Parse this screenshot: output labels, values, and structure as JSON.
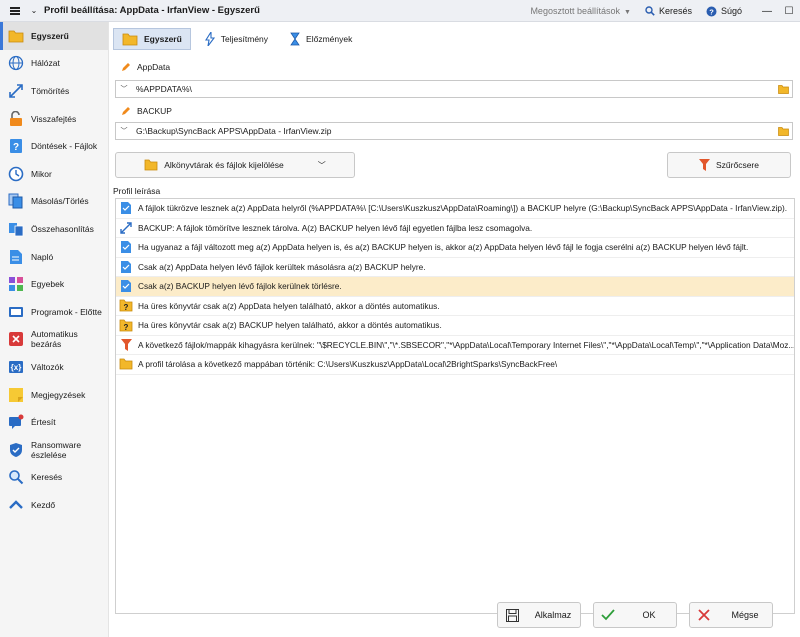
{
  "window": {
    "title": "Profil beállítása: AppData - IrfanView - Egyszerű",
    "shared_settings": "Megosztott beállítások",
    "search": "Keresés",
    "help": "Súgó"
  },
  "sidebar": {
    "items": [
      {
        "label": "Egyszerű",
        "icon": "folder-icon"
      },
      {
        "label": "Hálózat",
        "icon": "network-icon"
      },
      {
        "label": "Tömörítés",
        "icon": "compress-icon"
      },
      {
        "label": "Visszafejtés",
        "icon": "unlock-icon"
      },
      {
        "label": "Döntések - Fájlok",
        "icon": "question-icon"
      },
      {
        "label": "Mikor",
        "icon": "clock-icon"
      },
      {
        "label": "Másolás/Törlés",
        "icon": "copy-icon"
      },
      {
        "label": "Összehasonlítás",
        "icon": "compare-icon"
      },
      {
        "label": "Napló",
        "icon": "log-icon"
      },
      {
        "label": "Egyebek",
        "icon": "misc-icon"
      },
      {
        "label": "Programok - Előtte",
        "icon": "programs-icon"
      },
      {
        "label": "Automatikus bezárás",
        "icon": "auto-close-icon"
      },
      {
        "label": "Változók",
        "icon": "variables-icon"
      },
      {
        "label": "Megjegyzések",
        "icon": "notes-icon"
      },
      {
        "label": "Értesít",
        "icon": "notify-icon"
      },
      {
        "label": "Ransomware észlelése",
        "icon": "ransomware-icon"
      },
      {
        "label": "Keresés",
        "icon": "search-icon"
      },
      {
        "label": "Kezdő",
        "icon": "beginner-icon"
      }
    ]
  },
  "tabs": [
    {
      "label": "Egyszerű"
    },
    {
      "label": "Teljesítmény"
    },
    {
      "label": "Előzmények"
    }
  ],
  "source": {
    "label": "AppData",
    "value": "%APPDATA%\\"
  },
  "destination": {
    "label": "BACKUP",
    "value": "G:\\Backup\\SyncBack APPS\\AppData - IrfanView.zip"
  },
  "buttons": {
    "subdirs": "Alkönyvtárak és fájlok kijelölése",
    "filter": "Szűrőcsere",
    "apply": "Alkalmaz",
    "ok": "OK",
    "cancel": "Mégse"
  },
  "profile": {
    "label": "Profil leírása",
    "rows": [
      {
        "icon": "doc-icon",
        "text": "A fájlok tükrözve lesznek a(z) AppData helyről (%APPDATA%\\ [C:\\Users\\Kuszkusz\\AppData\\Roaming\\]) a BACKUP helyre (G:\\Backup\\SyncBack APPS\\AppData - IrfanView.zip)."
      },
      {
        "icon": "compress-icon",
        "text": "BACKUP: A fájlok tömörítve lesznek tárolva. A(z) BACKUP helyen lévő fájl egyetlen fájlba lesz csomagolva."
      },
      {
        "icon": "doc-icon",
        "text": "Ha ugyanaz a fájl változott meg a(z) AppData helyen is, és a(z) BACKUP helyen is, akkor a(z) AppData helyen lévő fájl le fogja cserélni a(z) BACKUP helyen lévő fájlt."
      },
      {
        "icon": "doc-icon",
        "text": "Csak a(z) AppData helyen lévő fájlok kerültek másolásra a(z) BACKUP helyre."
      },
      {
        "icon": "doc-icon",
        "text": "Csak a(z) BACKUP helyen lévő fájlok kerülnek törlésre."
      },
      {
        "icon": "folder-question-icon",
        "text": "Ha üres könyvtár csak a(z) AppData helyen található, akkor a döntés automatikus."
      },
      {
        "icon": "folder-question-icon",
        "text": "Ha üres könyvtár csak a(z) BACKUP helyen található, akkor a döntés automatikus."
      },
      {
        "icon": "filter-icon",
        "text": "A következő fájlok/mappák kihagyásra kerülnek: \"\\$RECYCLE.BIN\\\",\"\\*.SBSECOR\",\"*\\AppData\\Local\\Temporary Internet Files\\\",\"*\\AppData\\Local\\Temp\\\",\"*\\Application Data\\Moz..."
      },
      {
        "icon": "folder-icon",
        "text": "A profil tárolása a következő mappában történik: C:\\Users\\Kuszkusz\\AppData\\Local\\2BrightSparks\\SyncBackFree\\"
      }
    ]
  },
  "colors": {
    "accent": "#3b78d8",
    "highlight_row": "#fcecc9",
    "folder": "#f2b72a"
  }
}
